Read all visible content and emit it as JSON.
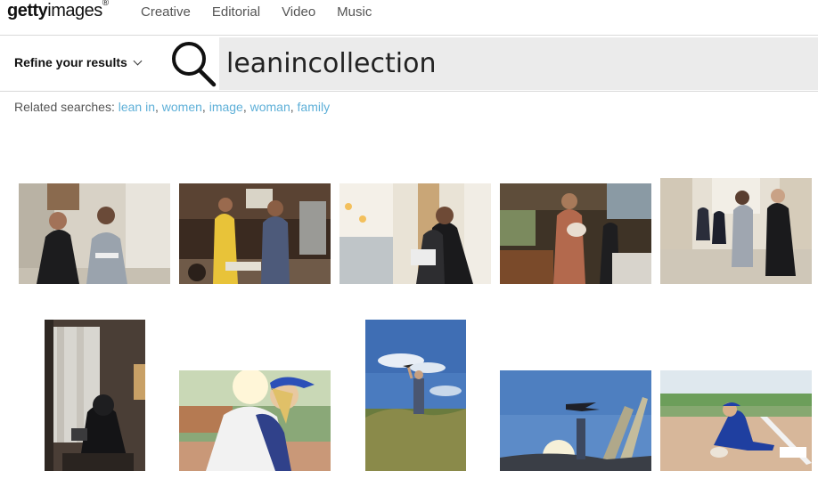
{
  "logo": {
    "bold": "getty",
    "regular": "images",
    "reg_mark": "®"
  },
  "nav": [
    "Creative",
    "Editorial",
    "Video",
    "Music"
  ],
  "refine_label": "Refine your results",
  "search": {
    "value": "leanincollection"
  },
  "related": {
    "label": "Related searches:",
    "terms": [
      "lean in",
      "women",
      "image",
      "woman",
      "family"
    ]
  },
  "images": [
    {
      "description": "two women in office, one in judge robe"
    },
    {
      "description": "farmers market workers with produce"
    },
    {
      "description": "women in graduation gowns with laptop"
    },
    {
      "description": "man holding baby in workshop"
    },
    {
      "description": "group of professionals walking in hallway"
    },
    {
      "description": "woman in hijab reading tablet by window"
    },
    {
      "description": "softball player in blue cap"
    },
    {
      "description": "person holding toy plane on dune"
    },
    {
      "description": "hand holding airplane toy against sky"
    },
    {
      "description": "softball player sliding to base"
    }
  ],
  "colors": {
    "accent_link": "#5fb0d8",
    "search_bg": "#ebebeb"
  }
}
